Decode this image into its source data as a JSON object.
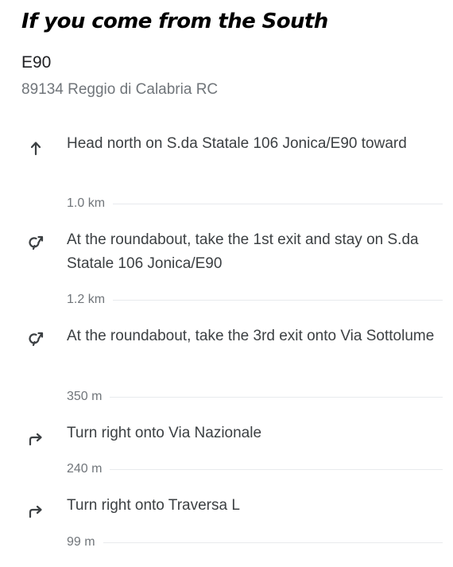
{
  "title": "If you come from the South",
  "destination": {
    "name": "E90",
    "address": "89134 Reggio di Calabria RC"
  },
  "steps": [
    {
      "icon": "arrow-up-icon",
      "instruction": "Head north on S.da Statale 106 Jonica/E90 toward",
      "distance": "1.0 km"
    },
    {
      "icon": "roundabout-icon",
      "instruction": "At the roundabout, take the 1st exit and stay on S.da Statale 106 Jonica/E90",
      "distance": "1.2 km"
    },
    {
      "icon": "roundabout-icon",
      "instruction": "At the roundabout, take the 3rd exit onto Via Sottolume",
      "distance": "350 m"
    },
    {
      "icon": "turn-right-icon",
      "instruction": "Turn right onto Via Nazionale",
      "distance": "240 m"
    },
    {
      "icon": "turn-right-icon",
      "instruction": "Turn right onto Traversa L",
      "distance": "99 m"
    }
  ]
}
